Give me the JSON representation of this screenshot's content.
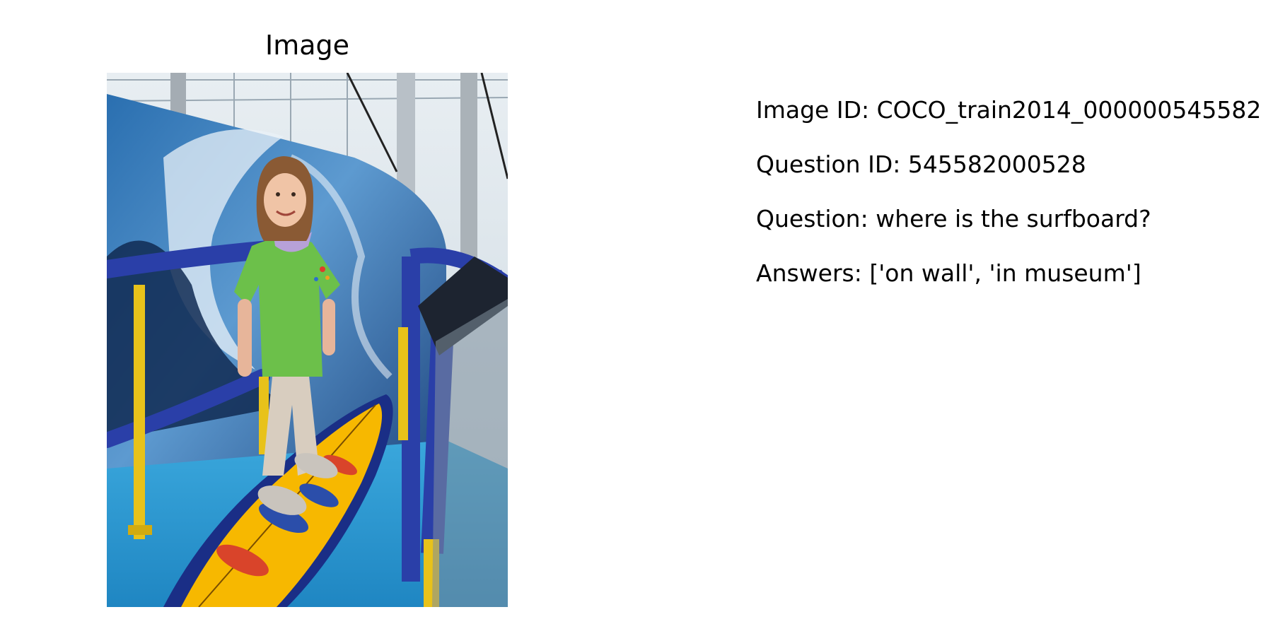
{
  "panel": {
    "title": "Image"
  },
  "info": {
    "image_id": "Image ID: COCO_train2014_000000545582",
    "question_id": "Question ID: 545582000528",
    "question": "Question: where is the surfboard?",
    "answers": "Answers: ['on wall', 'in museum']"
  },
  "photo": {
    "description_icon": "photo-girl-on-surfboard-exhibit",
    "colors": {
      "wave_blue": "#2a6fb0",
      "floor_blue": "#2f9fd6",
      "rail_blue": "#2a3fa8",
      "rail_yellow": "#e8c21a",
      "board_yellow": "#f7b800",
      "shirt_green": "#6cc04a",
      "pants": "#d8cdbf"
    }
  }
}
